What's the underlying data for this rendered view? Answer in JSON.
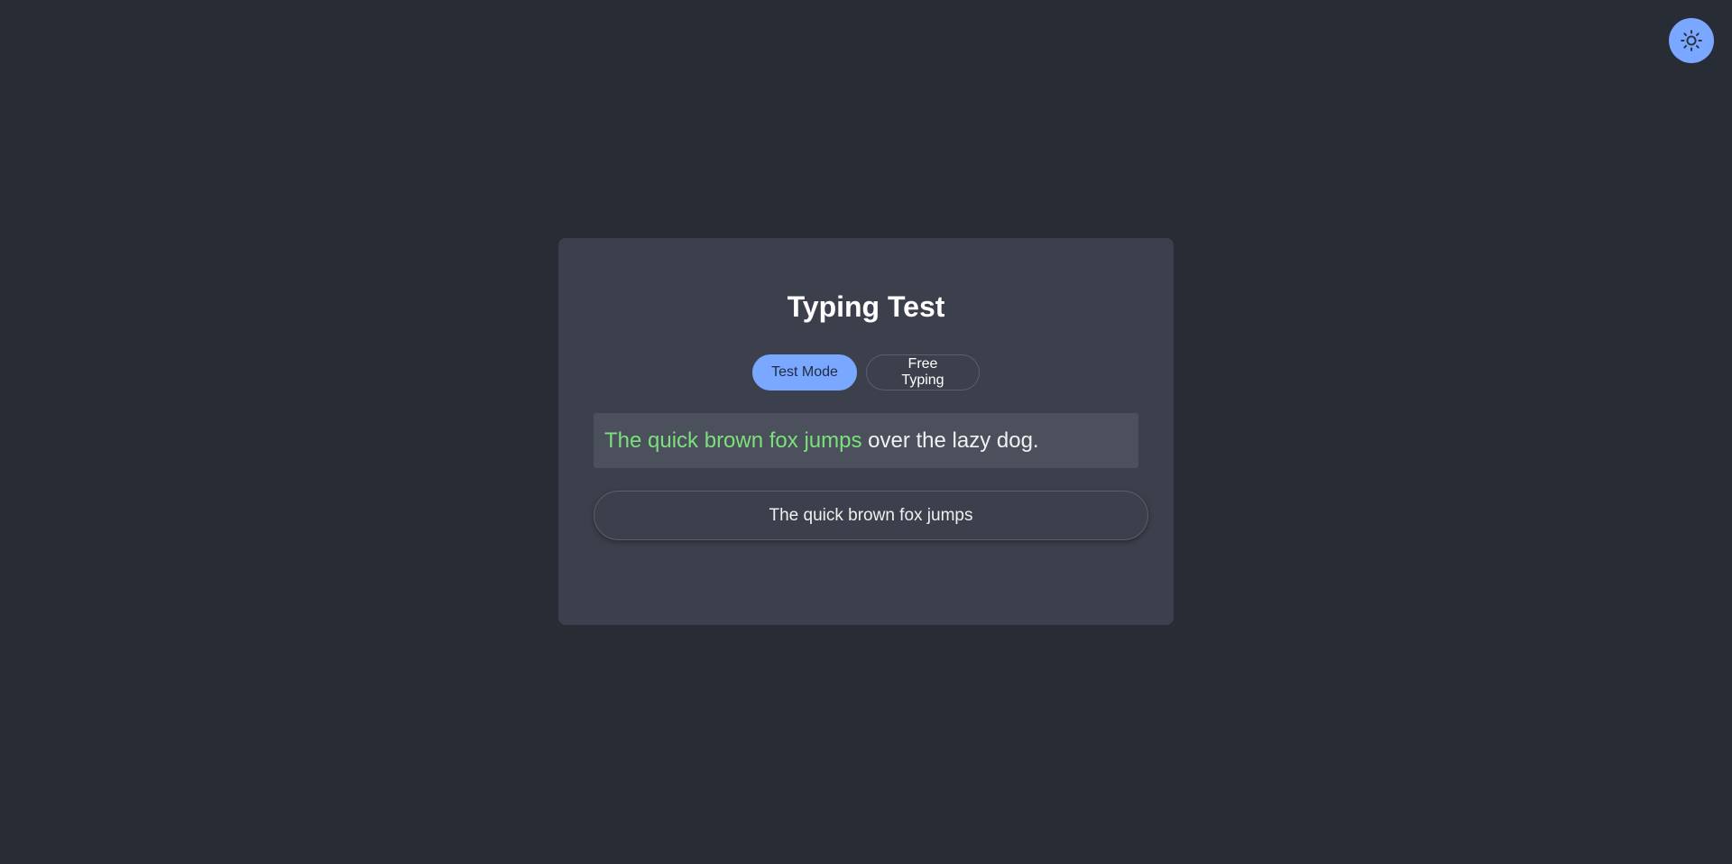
{
  "theme_toggle": {
    "icon": "sun-icon",
    "color": "#7aa7ff"
  },
  "card": {
    "title": "Typing Test"
  },
  "modes": {
    "test_mode": "Test Mode",
    "free_typing": "Free Typing",
    "active": "Test Mode"
  },
  "prompt": {
    "typed": "The quick brown fox jumps",
    "remaining": " over the lazy dog.",
    "typed_color": "#7be07b"
  },
  "input": {
    "value": "The quick brown fox jumps"
  }
}
